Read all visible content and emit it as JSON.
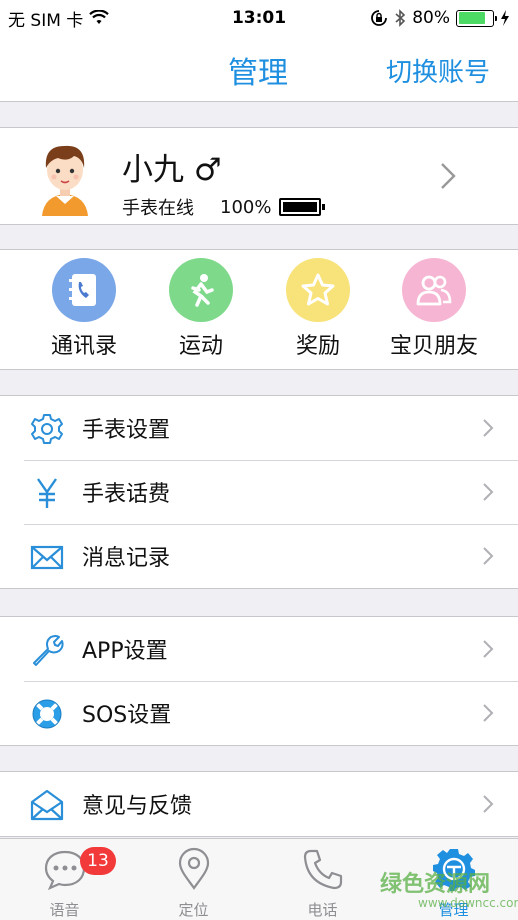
{
  "status_bar": {
    "carrier": "无 SIM 卡",
    "time": "13:01",
    "battery_pct": "80%"
  },
  "nav": {
    "title": "管理",
    "switch_account": "切换账号"
  },
  "profile": {
    "name": "小九 ♂",
    "watch_status": "手表在线",
    "battery": "100%"
  },
  "shortcuts": [
    {
      "label": "通讯录",
      "icon": "phone-book-icon",
      "color": "#7aa7e8"
    },
    {
      "label": "运动",
      "icon": "running-icon",
      "color": "#7fd98b"
    },
    {
      "label": "奖励",
      "icon": "star-icon",
      "color": "#f8e27a"
    },
    {
      "label": "宝贝朋友",
      "icon": "friends-icon",
      "color": "#f6b6d3"
    }
  ],
  "menu": {
    "group1": [
      {
        "label": "手表设置",
        "icon": "gear-icon"
      },
      {
        "label": "手表话费",
        "icon": "yuan-icon"
      },
      {
        "label": "消息记录",
        "icon": "envelope-icon"
      }
    ],
    "group2": [
      {
        "label": "APP设置",
        "icon": "wrench-icon"
      },
      {
        "label": "SOS设置",
        "icon": "lifebuoy-icon"
      }
    ],
    "group3": [
      {
        "label": "意见与反馈",
        "icon": "feedback-mail-icon"
      }
    ]
  },
  "tabs": [
    {
      "label": "语音",
      "icon": "chat-icon",
      "badge": "13"
    },
    {
      "label": "定位",
      "icon": "location-pin-icon"
    },
    {
      "label": "电话",
      "icon": "phone-icon"
    },
    {
      "label": "管理",
      "icon": "manage-icon",
      "active": true
    }
  ],
  "watermark": {
    "text": "绿色资源网",
    "sub": "www.downcc.com"
  },
  "colors": {
    "accent": "#1f8fe0",
    "background": "#efeff4",
    "badge": "#f33a3a"
  }
}
